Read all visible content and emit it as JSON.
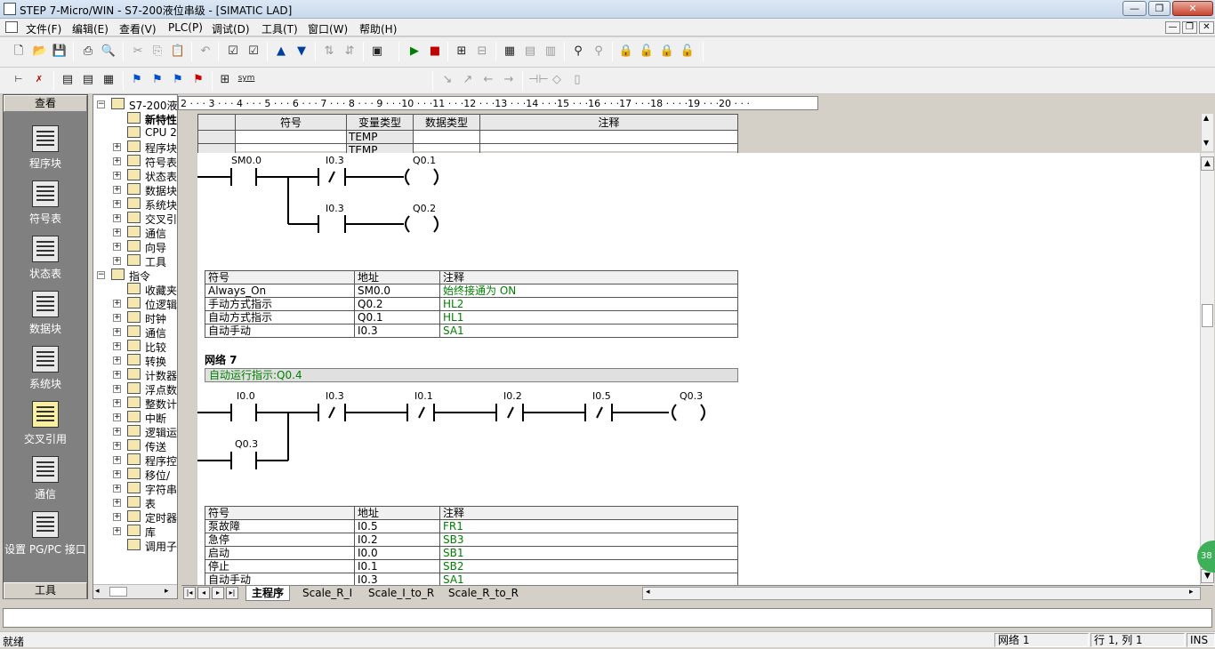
{
  "title": "STEP 7-Micro/WIN - S7-200液位串级 - [SIMATIC LAD]",
  "window_buttons": [
    "—",
    "❐",
    "✕"
  ],
  "menu": [
    "文件(F)",
    "编辑(E)",
    "查看(V)",
    "PLC(P)",
    "调试(D)",
    "工具(T)",
    "窗口(W)",
    "帮助(H)"
  ],
  "mdi_buttons": [
    "—",
    "❐",
    "✕"
  ],
  "toolbar2_sym_label": "sym",
  "nav": {
    "header": "查看",
    "footer": "工具",
    "items": [
      {
        "label": "程序块",
        "icon": "program-block-icon"
      },
      {
        "label": "符号表",
        "icon": "symbol-table-icon"
      },
      {
        "label": "状态表",
        "icon": "status-table-icon"
      },
      {
        "label": "数据块",
        "icon": "data-block-icon"
      },
      {
        "label": "系统块",
        "icon": "system-block-icon"
      },
      {
        "label": "交叉引用",
        "icon": "cross-reference-icon"
      },
      {
        "label": "通信",
        "icon": "communication-icon"
      },
      {
        "label": "设置 PG/PC 接口",
        "icon": "pgpc-interface-icon"
      }
    ]
  },
  "tree": [
    {
      "label": "S7-200液",
      "level": 0,
      "exp": "−"
    },
    {
      "label": "新特性",
      "level": 1,
      "exp": "",
      "bold": true
    },
    {
      "label": "CPU 2",
      "level": 1,
      "exp": ""
    },
    {
      "label": "程序块",
      "level": 1,
      "exp": "+"
    },
    {
      "label": "符号表",
      "level": 1,
      "exp": "+"
    },
    {
      "label": "状态表",
      "level": 1,
      "exp": "+"
    },
    {
      "label": "数据块",
      "level": 1,
      "exp": "+"
    },
    {
      "label": "系统块",
      "level": 1,
      "exp": "+"
    },
    {
      "label": "交叉引",
      "level": 1,
      "exp": "+"
    },
    {
      "label": "通信",
      "level": 1,
      "exp": "+"
    },
    {
      "label": "向导",
      "level": 1,
      "exp": "+"
    },
    {
      "label": "工具",
      "level": 1,
      "exp": "+"
    },
    {
      "label": "指令",
      "level": 0,
      "exp": "−"
    },
    {
      "label": "收藏夹",
      "level": 1,
      "exp": ""
    },
    {
      "label": "位逻辑",
      "level": 1,
      "exp": "+"
    },
    {
      "label": "时钟",
      "level": 1,
      "exp": "+"
    },
    {
      "label": "通信",
      "level": 1,
      "exp": "+"
    },
    {
      "label": "比较",
      "level": 1,
      "exp": "+"
    },
    {
      "label": "转换",
      "level": 1,
      "exp": "+"
    },
    {
      "label": "计数器",
      "level": 1,
      "exp": "+"
    },
    {
      "label": "浮点数",
      "level": 1,
      "exp": "+"
    },
    {
      "label": "整数计",
      "level": 1,
      "exp": "+"
    },
    {
      "label": "中断",
      "level": 1,
      "exp": "+"
    },
    {
      "label": "逻辑运",
      "level": 1,
      "exp": "+"
    },
    {
      "label": "传送",
      "level": 1,
      "exp": "+"
    },
    {
      "label": "程序控",
      "level": 1,
      "exp": "+"
    },
    {
      "label": "移位/",
      "level": 1,
      "exp": "+"
    },
    {
      "label": "字符串",
      "level": 1,
      "exp": "+"
    },
    {
      "label": "表",
      "level": 1,
      "exp": "+"
    },
    {
      "label": "定时器",
      "level": 1,
      "exp": "+"
    },
    {
      "label": "库",
      "level": 1,
      "exp": "+"
    },
    {
      "label": "调用子",
      "level": 1,
      "exp": ""
    }
  ],
  "ruler": "2 · · · 3 · · · 4 · · · 5 · · · 6 · · · 7 · · · 8 · · · 9 · · ·10 · · ·11 · · ·12 · · ·13 · · ·14 · · ·15 · · ·16 · · ·17 · · ·18 · · · ·19 · · ·20 · · ·",
  "var_table": {
    "headers": [
      "",
      "符号",
      "变量类型",
      "数据类型",
      "注释"
    ],
    "rows": [
      [
        "",
        "",
        "TEMP",
        "",
        ""
      ],
      [
        "",
        "",
        "TEMP",
        "",
        ""
      ]
    ]
  },
  "network6": {
    "contacts": [
      "SM0.0",
      "I0.3",
      "I0.3"
    ],
    "coils": [
      "Q0.1",
      "Q0.2"
    ],
    "symbols": {
      "headers": [
        "符号",
        "地址",
        "注释"
      ],
      "rows": [
        [
          "Always_On",
          "SM0.0",
          "始终接通为 ON"
        ],
        [
          "手动方式指示",
          "Q0.2",
          "HL2"
        ],
        [
          "自动方式指示",
          "Q0.1",
          "HL1"
        ],
        [
          "自动手动",
          "I0.3",
          "SA1"
        ]
      ]
    }
  },
  "network7": {
    "label": "网络 7",
    "comment": "自动运行指示:Q0.4",
    "contacts": [
      "I0.0",
      "I0.3",
      "I0.1",
      "I0.2",
      "I0.5",
      "Q0.3"
    ],
    "coil": "Q0.3",
    "symbols": {
      "headers": [
        "符号",
        "地址",
        "注释"
      ],
      "rows": [
        [
          "泵故障",
          "I0.5",
          "FR1"
        ],
        [
          "急停",
          "I0.2",
          "SB3"
        ],
        [
          "启动",
          "I0.0",
          "SB1"
        ],
        [
          "停止",
          "I0.1",
          "SB2"
        ],
        [
          "自动手动",
          "I0.3",
          "SA1"
        ]
      ]
    }
  },
  "tabs": [
    "主程序",
    "Scale_R_I",
    "Scale_I_to_R",
    "Scale_R_to_R"
  ],
  "status": {
    "left": "就绪",
    "network": "网络 1",
    "position": "行 1, 列 1",
    "mode": "INS"
  },
  "badge": "38"
}
